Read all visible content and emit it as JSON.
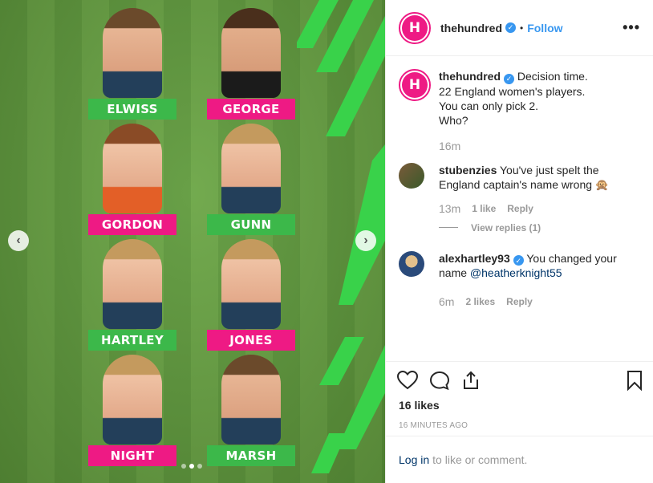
{
  "post": {
    "username": "thehundred",
    "follow_label": "Follow",
    "separator": "•",
    "more_label": "•••",
    "avatar_letter": "H",
    "accent_color": "#ee1a84"
  },
  "photo": {
    "players": [
      {
        "name": "ELWISS",
        "plate": "green"
      },
      {
        "name": "GEORGE",
        "plate": "pink"
      },
      {
        "name": "GORDON",
        "plate": "pink"
      },
      {
        "name": "GUNN",
        "plate": "green"
      },
      {
        "name": "HARTLEY",
        "plate": "green"
      },
      {
        "name": "JONES",
        "plate": "pink"
      },
      {
        "name": "NIGHT",
        "plate": "pink"
      },
      {
        "name": "MARSH",
        "plate": "green"
      }
    ],
    "prev_arrow": "‹",
    "next_arrow": "›",
    "carousel_dots": 3,
    "active_dot": 2
  },
  "caption": {
    "username": "thehundred",
    "lines": [
      "Decision time.",
      "22 England women's players.",
      "You can only pick 2.",
      "Who?"
    ],
    "time": "16m"
  },
  "comments": [
    {
      "username": "stubenzies",
      "text_line1": "You've just spelt the",
      "text_line2": "England captain's name wrong 🙊",
      "time": "13m",
      "likes": "1 like",
      "reply_label": "Reply",
      "view_replies": "View replies (1)"
    },
    {
      "username": "alexhartley93",
      "text_line1": "You changed your",
      "text_line2_prefix": "name",
      "mention": "@heatherknight55",
      "time": "6m",
      "likes": "2 likes",
      "reply_label": "Reply"
    }
  ],
  "footer": {
    "likes": "16 likes",
    "ago": "16 MINUTES AGO",
    "login_link": "Log in",
    "login_text": "to like or comment."
  }
}
